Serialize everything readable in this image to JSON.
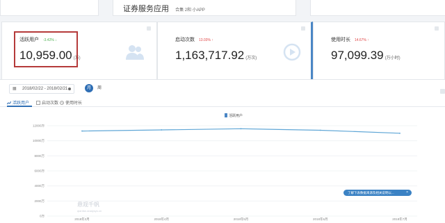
{
  "header": {
    "title": "证券服务应用",
    "subtitle": "合集 2和 小APP"
  },
  "cards": [
    {
      "label": "活跃用户",
      "pct": "-3.42%",
      "pct_arrow": "↓",
      "value": "10,959.00",
      "unit": "(万)",
      "pct_color": "green"
    },
    {
      "label": "启动次数",
      "pct": "13.03%",
      "pct_arrow": "↑",
      "value": "1,163,717.92",
      "unit": "(万次)",
      "pct_color": "red"
    },
    {
      "label": "使用时长",
      "pct": "14.67%",
      "pct_arrow": "↑",
      "value": "97,099.39",
      "unit": "(万小时)",
      "pct_color": "red"
    }
  ],
  "filters": {
    "date_range": "2018/02/22 - 2018/02/21",
    "calendar_icon": "calendar-icon",
    "month_label": "月",
    "week_label": "周"
  },
  "tabs": [
    {
      "label": "活跃用户",
      "icon": "chart-line-icon",
      "active": true
    },
    {
      "label": "启动次数",
      "icon": "checkbox-icon",
      "active": false
    },
    {
      "label": "使用时长",
      "icon": "clock-icon",
      "active": false
    }
  ],
  "chart_data": {
    "type": "line",
    "legend": "活跃用户",
    "categories": [
      "2018年2月",
      "2018年4月",
      "2018年5月",
      "2018年6月",
      "2018年7月"
    ],
    "y_tick_labels": [
      "0万",
      "2000万",
      "4000万",
      "6000万",
      "8000万",
      "10000万",
      "12000万"
    ],
    "ylim": [
      0,
      12000
    ],
    "series": [
      {
        "name": "活跃用户",
        "values": [
          11300,
          11450,
          11600,
          11400,
          11000
        ]
      }
    ],
    "color": "#5fa6d6",
    "grid": true
  },
  "tip": "了解下表数据来源及相关说明以...",
  "watermark": {
    "main": "悬观千帆",
    "sub": "qianfan.analysys.cn"
  },
  "colors": {
    "accent": "#2f6fb5",
    "highlight_border": "#b53a3a",
    "line": "#5fa6d6"
  }
}
